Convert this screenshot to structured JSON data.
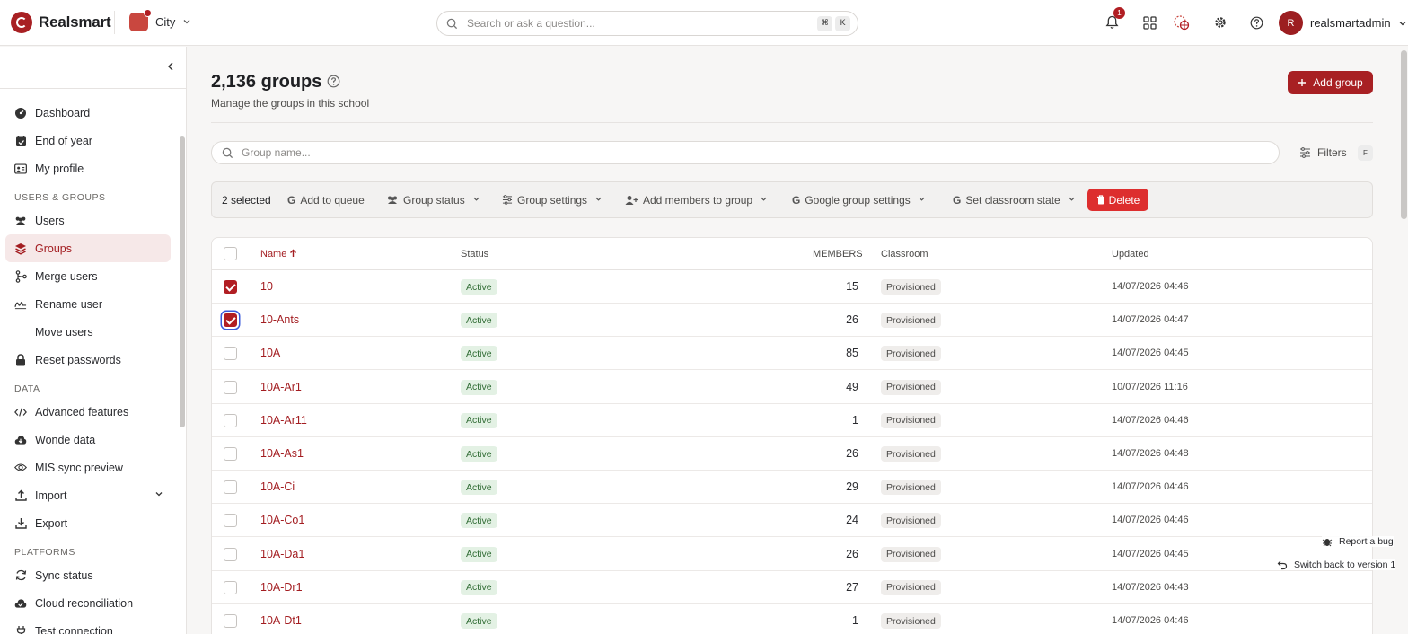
{
  "app": {
    "name": "Realsmart"
  },
  "school": {
    "name": "City"
  },
  "top_search": {
    "placeholder": "Search or ask a question...",
    "shortcut_keys": [
      "⌘",
      "K"
    ]
  },
  "notifications": {
    "count": "1"
  },
  "user": {
    "initial": "R",
    "name": "realsmartadmin"
  },
  "sidebar": {
    "groups": [
      {
        "section": "",
        "items": [
          {
            "label": "Dashboard",
            "icon": "gauge-icon"
          },
          {
            "label": "End of year",
            "icon": "calendar-check-icon"
          },
          {
            "label": "My profile",
            "icon": "id-card-icon"
          }
        ]
      },
      {
        "section": "USERS & GROUPS",
        "items": [
          {
            "label": "Users",
            "icon": "users-icon"
          },
          {
            "label": "Groups",
            "icon": "layers-icon",
            "active": true
          },
          {
            "label": "Merge users",
            "icon": "merge-icon"
          },
          {
            "label": "Rename user",
            "icon": "signature-icon"
          },
          {
            "label": "Move users",
            "icon": ""
          },
          {
            "label": "Reset passwords",
            "icon": "lock-icon"
          }
        ]
      },
      {
        "section": "DATA",
        "items": [
          {
            "label": "Advanced features",
            "icon": "code-icon"
          },
          {
            "label": "Wonde data",
            "icon": "cloud-download-icon"
          },
          {
            "label": "MIS sync preview",
            "icon": "eye-icon"
          },
          {
            "label": "Import",
            "icon": "upload-icon",
            "expandable": true
          },
          {
            "label": "Export",
            "icon": "download-icon"
          }
        ]
      },
      {
        "section": "PLATFORMS",
        "items": [
          {
            "label": "Sync status",
            "icon": "sync-icon"
          },
          {
            "label": "Cloud reconciliation",
            "icon": "cloud-check-icon"
          },
          {
            "label": "Test connection",
            "icon": "plug-icon"
          }
        ]
      }
    ]
  },
  "page": {
    "title": "2,136 groups",
    "subtitle": "Manage the groups in this school",
    "add_button": "Add group",
    "search_placeholder": "Group name...",
    "filters_label": "Filters",
    "filters_shortcut": "F"
  },
  "toolbar": {
    "selected": "2 selected",
    "add_to_queue": "Add to queue",
    "group_status": "Group status",
    "group_settings": "Group settings",
    "add_members": "Add members to group",
    "google_settings": "Google group settings",
    "classroom_state": "Set classroom state",
    "delete": "Delete"
  },
  "table": {
    "columns": {
      "name": "Name",
      "status": "Status",
      "members": "MEMBERS",
      "classroom": "Classroom",
      "updated": "Updated"
    },
    "rows": [
      {
        "name": "10",
        "status": "Active",
        "members": "15",
        "classroom": "Provisioned",
        "updated": "14/07/2026 04:46",
        "checked": true
      },
      {
        "name": "10-Ants",
        "status": "Active",
        "members": "26",
        "classroom": "Provisioned",
        "updated": "14/07/2026 04:47",
        "checked": true,
        "focused": true
      },
      {
        "name": "10A",
        "status": "Active",
        "members": "85",
        "classroom": "Provisioned",
        "updated": "14/07/2026 04:45",
        "checked": false
      },
      {
        "name": "10A-Ar1",
        "status": "Active",
        "members": "49",
        "classroom": "Provisioned",
        "updated": "10/07/2026 11:16",
        "checked": false
      },
      {
        "name": "10A-Ar11",
        "status": "Active",
        "members": "1",
        "classroom": "Provisioned",
        "updated": "14/07/2026 04:46",
        "checked": false
      },
      {
        "name": "10A-As1",
        "status": "Active",
        "members": "26",
        "classroom": "Provisioned",
        "updated": "14/07/2026 04:48",
        "checked": false
      },
      {
        "name": "10A-Ci",
        "status": "Active",
        "members": "29",
        "classroom": "Provisioned",
        "updated": "14/07/2026 04:46",
        "checked": false
      },
      {
        "name": "10A-Co1",
        "status": "Active",
        "members": "24",
        "classroom": "Provisioned",
        "updated": "14/07/2026 04:46",
        "checked": false
      },
      {
        "name": "10A-Da1",
        "status": "Active",
        "members": "26",
        "classroom": "Provisioned",
        "updated": "14/07/2026 04:45",
        "checked": false
      },
      {
        "name": "10A-Dr1",
        "status": "Active",
        "members": "27",
        "classroom": "Provisioned",
        "updated": "14/07/2026 04:43",
        "checked": false
      },
      {
        "name": "10A-Dt1",
        "status": "Active",
        "members": "1",
        "classroom": "Provisioned",
        "updated": "14/07/2026 04:46",
        "checked": false
      }
    ]
  },
  "floating": {
    "report_bug": "Report a bug",
    "switch_version": "Switch back to version 1"
  },
  "colors": {
    "brand": "#a82023",
    "active_nav_bg": "#f6e8e8",
    "delete": "#dd2e2e",
    "active_badge_bg": "#e3f1e4"
  }
}
